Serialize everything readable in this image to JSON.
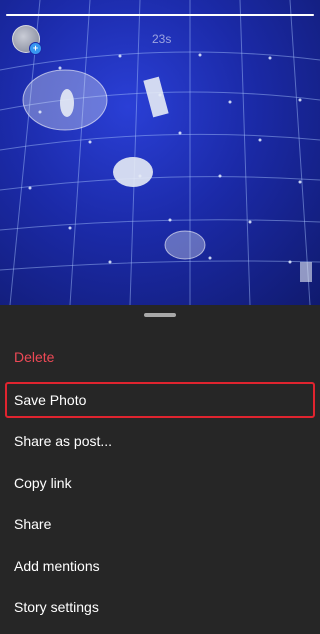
{
  "story": {
    "elapsed_time": "23s",
    "progress_fraction": 1.0,
    "avatar_badge": "+"
  },
  "menu": {
    "items": [
      {
        "label": "Delete",
        "style": "danger",
        "highlighted": false
      },
      {
        "label": "Save Photo",
        "style": "normal",
        "highlighted": true
      },
      {
        "label": "Share as post...",
        "style": "normal",
        "highlighted": false
      },
      {
        "label": "Copy link",
        "style": "normal",
        "highlighted": false
      },
      {
        "label": "Share",
        "style": "normal",
        "highlighted": false
      },
      {
        "label": "Add mentions",
        "style": "normal",
        "highlighted": false
      },
      {
        "label": "Story settings",
        "style": "normal",
        "highlighted": false
      }
    ]
  },
  "colors": {
    "sheet_background": "#262626",
    "danger_text": "#ed4956",
    "highlight_border": "#e0242f",
    "story_background": "#1b2aa8"
  }
}
